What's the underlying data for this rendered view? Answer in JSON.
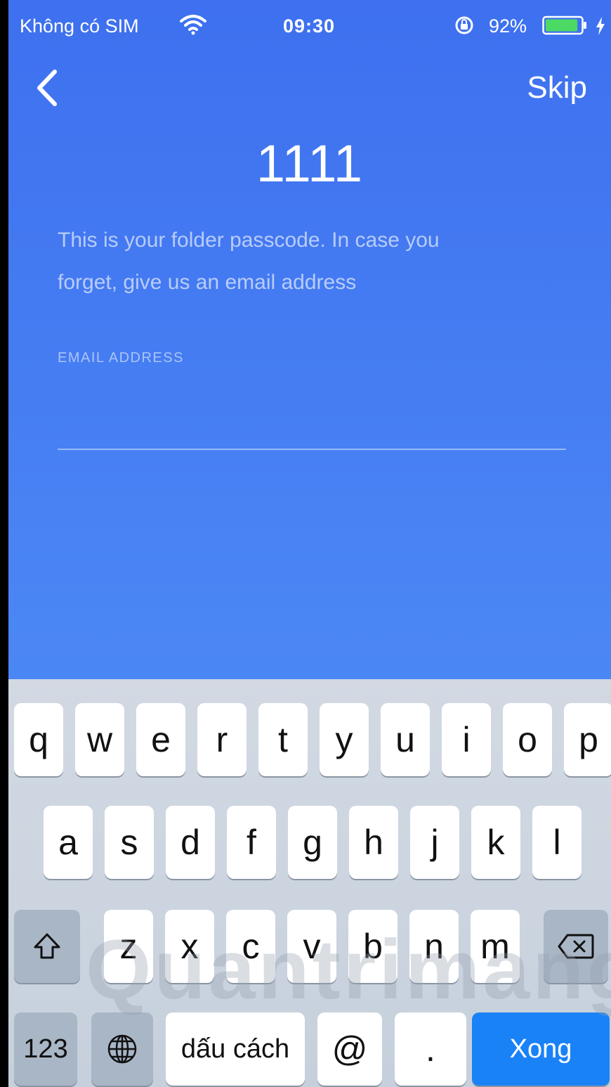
{
  "status_bar": {
    "carrier": "Không có SIM",
    "time": "09:30",
    "battery_percent": "92%",
    "battery_level": 0.92,
    "icons": [
      "wifi-icon",
      "rotation-lock-icon",
      "battery-icon",
      "charging-bolt-icon"
    ]
  },
  "nav": {
    "back_icon": "chevron-left-icon",
    "skip_label": "Skip"
  },
  "passcode": "1111",
  "description": "This is your folder passcode. In case you forget, give us an email address",
  "email": {
    "label": "EMAIL ADDRESS",
    "value": "",
    "placeholder": ""
  },
  "keyboard": {
    "row1": [
      "q",
      "w",
      "e",
      "r",
      "t",
      "y",
      "u",
      "i",
      "o",
      "p"
    ],
    "row2": [
      "a",
      "s",
      "d",
      "f",
      "g",
      "h",
      "j",
      "k",
      "l"
    ],
    "row3": [
      "z",
      "x",
      "c",
      "v",
      "b",
      "n",
      "m"
    ],
    "shift_icon": "shift-icon",
    "delete_icon": "delete-icon",
    "numbers_label": "123",
    "globe_icon": "globe-icon",
    "space_label": "dấu cách",
    "at_label": "@",
    "period_label": ".",
    "done_label": "Xong"
  },
  "watermark_text": "Quantrimang",
  "colors": {
    "background_top": "#3e70ef",
    "background_bottom": "#5193f8",
    "done_key": "#1a82f7",
    "battery_fill": "#4cd964"
  }
}
